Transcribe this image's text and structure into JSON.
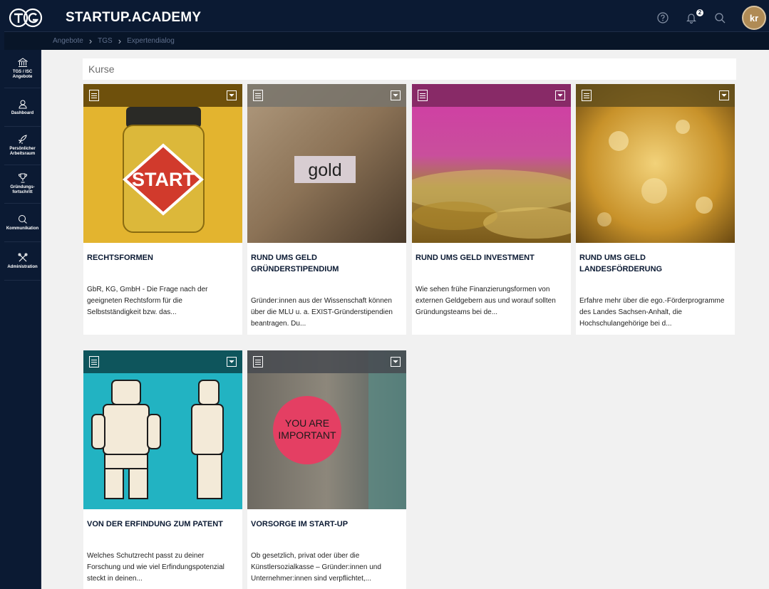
{
  "app": {
    "brand": "STARTUP.ACADEMY",
    "logo_text": "TG"
  },
  "header": {
    "avatar_initials": "kr",
    "notification_count": "2"
  },
  "breadcrumb": [
    "Angebote",
    "TGS",
    "Expertendialog"
  ],
  "sidebar": {
    "items": [
      {
        "label": "TGS / ISC Angebote",
        "icon": "bank-icon"
      },
      {
        "label": "Dashboard",
        "icon": "user-icon"
      },
      {
        "label": "Persönlicher Arbeitsraum",
        "icon": "rocket-icon"
      },
      {
        "label": "Gründungs-fortschritt",
        "icon": "trophy-icon"
      },
      {
        "label": "Kommunikation",
        "icon": "chat-icon"
      },
      {
        "label": "Administration",
        "icon": "tools-icon"
      }
    ]
  },
  "section": {
    "title": "Kurse"
  },
  "cards": [
    {
      "title": "RECHTSFORMEN",
      "desc": "GbR, KG, GmbH - Die Frage nach der geeigneten Rechtsform für die Selbstständigkeit bzw. das...",
      "bar_color": "#6b4f0f",
      "image_text": "START"
    },
    {
      "title": "RUND UMS GELD GRÜNDERSTIPENDIUM",
      "desc": "Gründer:innen aus der Wissenschaft können über die MLU u. a. EXIST-Gründerstipendien beantragen. Du...",
      "bar_color": "#7a7468",
      "image_text": "gold"
    },
    {
      "title": "RUND UMS GELD INVESTMENT",
      "desc": "Wie sehen frühe Finanzierungsformen von externen Geldgebern aus und worauf sollten Gründungsteams bei de...",
      "bar_color": "#7a2a5c",
      "image_text": ""
    },
    {
      "title": "RUND UMS GELD LANDESFÖRDERUNG",
      "desc": "Erfahre mehr über die ego.-Förderprogramme des Landes Sachsen-Anhalt, die Hochschulangehörige bei d...",
      "bar_color": "#6b5520",
      "image_text": ""
    },
    {
      "title": "VON DER ERFINDUNG ZUM PATENT",
      "desc": "Welches Schutzrecht passt zu deiner Forschung und wie viel Erfindungspotenzial steckt in deinen...",
      "bar_color": "#11545a",
      "image_text": ""
    },
    {
      "title": "VORSORGE IM START-UP",
      "desc": "Ob gesetzlich, privat oder über die Künstlersozialkasse – Gründer:innen und Unternehmer:innen sind verpflichtet,...",
      "bar_color": "#4d5258",
      "image_text": "YOU ARE IMPORTANT"
    }
  ]
}
